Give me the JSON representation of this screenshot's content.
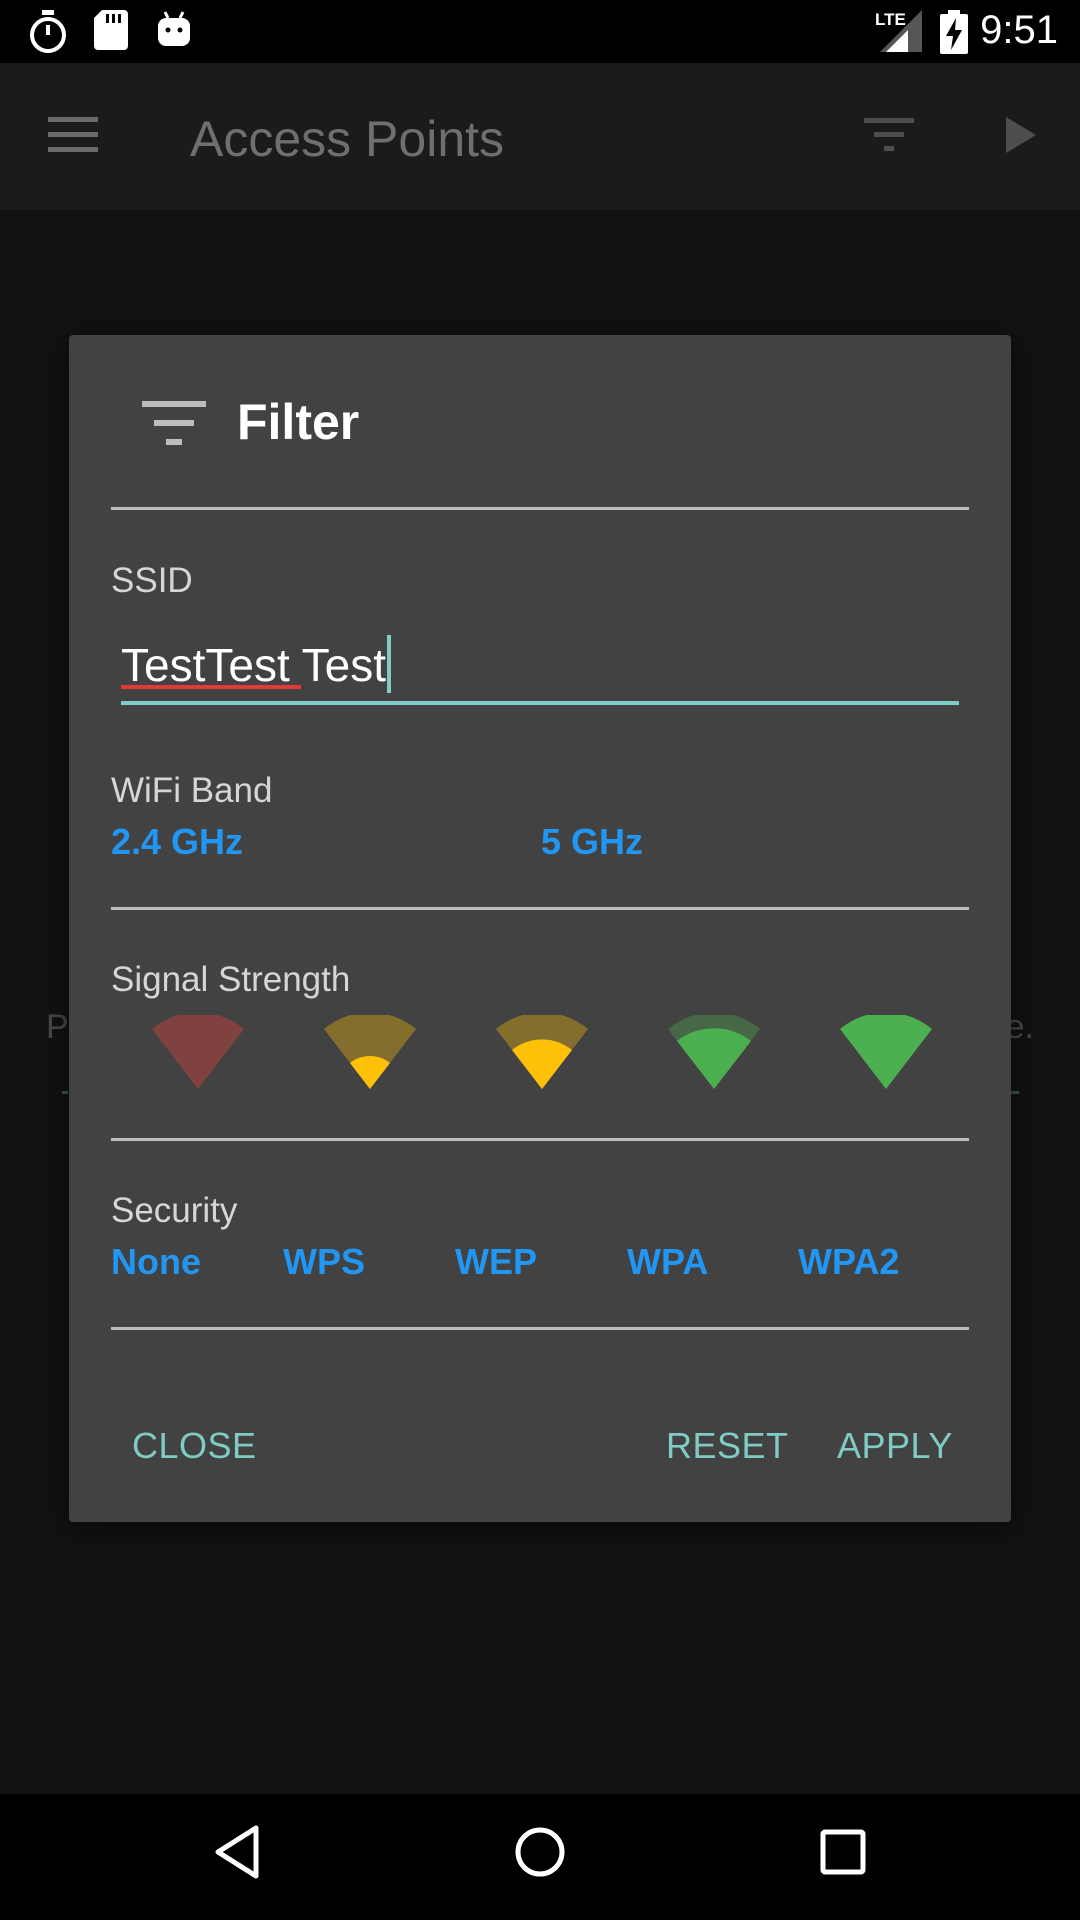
{
  "status_bar": {
    "time": "9:51",
    "network_label": "LTE",
    "icons": [
      "stopwatch-icon",
      "sd-card-icon",
      "android-icon",
      "cell-signal-icon",
      "battery-charging-icon"
    ]
  },
  "app_bar": {
    "title": "Access Points",
    "icons": [
      "menu-icon",
      "filter-icon",
      "play-icon"
    ]
  },
  "background": {
    "text_left": "P",
    "text_right": "e."
  },
  "dialog": {
    "title": "Filter",
    "title_icon": "filter-icon",
    "ssid": {
      "label": "SSID",
      "value": "TestTest Test"
    },
    "wifi_band": {
      "label": "WiFi Band",
      "options": [
        "2.4 GHz",
        "5 GHz"
      ]
    },
    "signal_strength": {
      "label": "Signal Strength",
      "levels": [
        {
          "name": "none",
          "level": 0,
          "color": "#f44336"
        },
        {
          "name": "weak",
          "level": 1,
          "color": "#ffc107"
        },
        {
          "name": "fair",
          "level": 2,
          "color": "#ffc107"
        },
        {
          "name": "good",
          "level": 3,
          "color": "#4caf50"
        },
        {
          "name": "excellent",
          "level": 4,
          "color": "#4caf50"
        }
      ]
    },
    "security": {
      "label": "Security",
      "options": [
        "None",
        "WPS",
        "WEP",
        "WPA",
        "WPA2"
      ]
    },
    "buttons": {
      "close": "CLOSE",
      "reset": "RESET",
      "apply": "APPLY"
    }
  },
  "colors": {
    "accent": "#80cbc4",
    "toggle_on": "#2196f3",
    "dialog_bg": "#424242",
    "spell_error": "#e53935"
  }
}
